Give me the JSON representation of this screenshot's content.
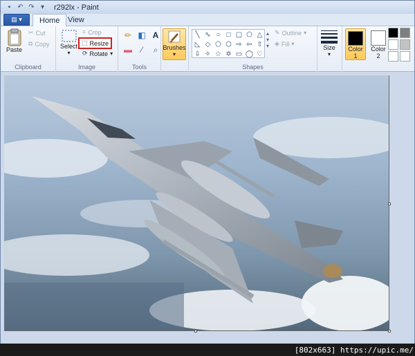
{
  "window": {
    "title": "r292lx - Paint"
  },
  "tabs": {
    "home": "Home",
    "view": "View"
  },
  "clipboard": {
    "paste": "Paste",
    "cut": "Cut",
    "copy": "Copy",
    "label": "Clipboard"
  },
  "image": {
    "select": "Select",
    "crop": "Crop",
    "resize": "Resize",
    "rotate": "Rotate",
    "label": "Image"
  },
  "tools": {
    "label": "Tools"
  },
  "brushes": {
    "label": "Brushes"
  },
  "shapes": {
    "outline": "Outline",
    "fill": "Fill",
    "label": "Shapes"
  },
  "size": {
    "label": "Size"
  },
  "colors": {
    "color1": "Color",
    "color1_num": "1",
    "color2": "Color",
    "color2_num": "2",
    "color1_value": "#000000",
    "color2_value": "#ffffff"
  },
  "watermark": {
    "text": "[802x663] https://upic.me/"
  }
}
